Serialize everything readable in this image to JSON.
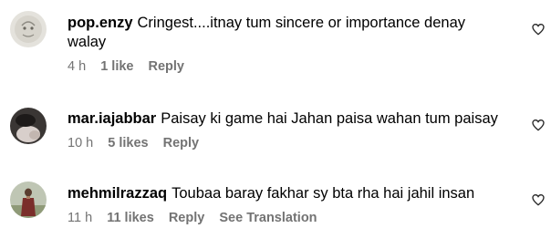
{
  "comments": [
    {
      "username": "pop.enzy",
      "text": "Cringest....itnay tum sincere or importance denay walay",
      "time": "4 h",
      "likes": "1 like",
      "reply": "Reply",
      "translate": ""
    },
    {
      "username": "mar.iajabbar",
      "text": "Paisay ki game hai Jahan paisa wahan tum paisay",
      "time": "10 h",
      "likes": "5 likes",
      "reply": "Reply",
      "translate": ""
    },
    {
      "username": "mehmilrazzaq",
      "text": "Toubaa baray fakhar sy bta rha hai jahil insan",
      "time": "11 h",
      "likes": "11 likes",
      "reply": "Reply",
      "translate": "See Translation"
    }
  ],
  "icons": {
    "like": "heart-outline-icon"
  },
  "colors": {
    "meta_text": "#737373",
    "text": "#000000"
  }
}
